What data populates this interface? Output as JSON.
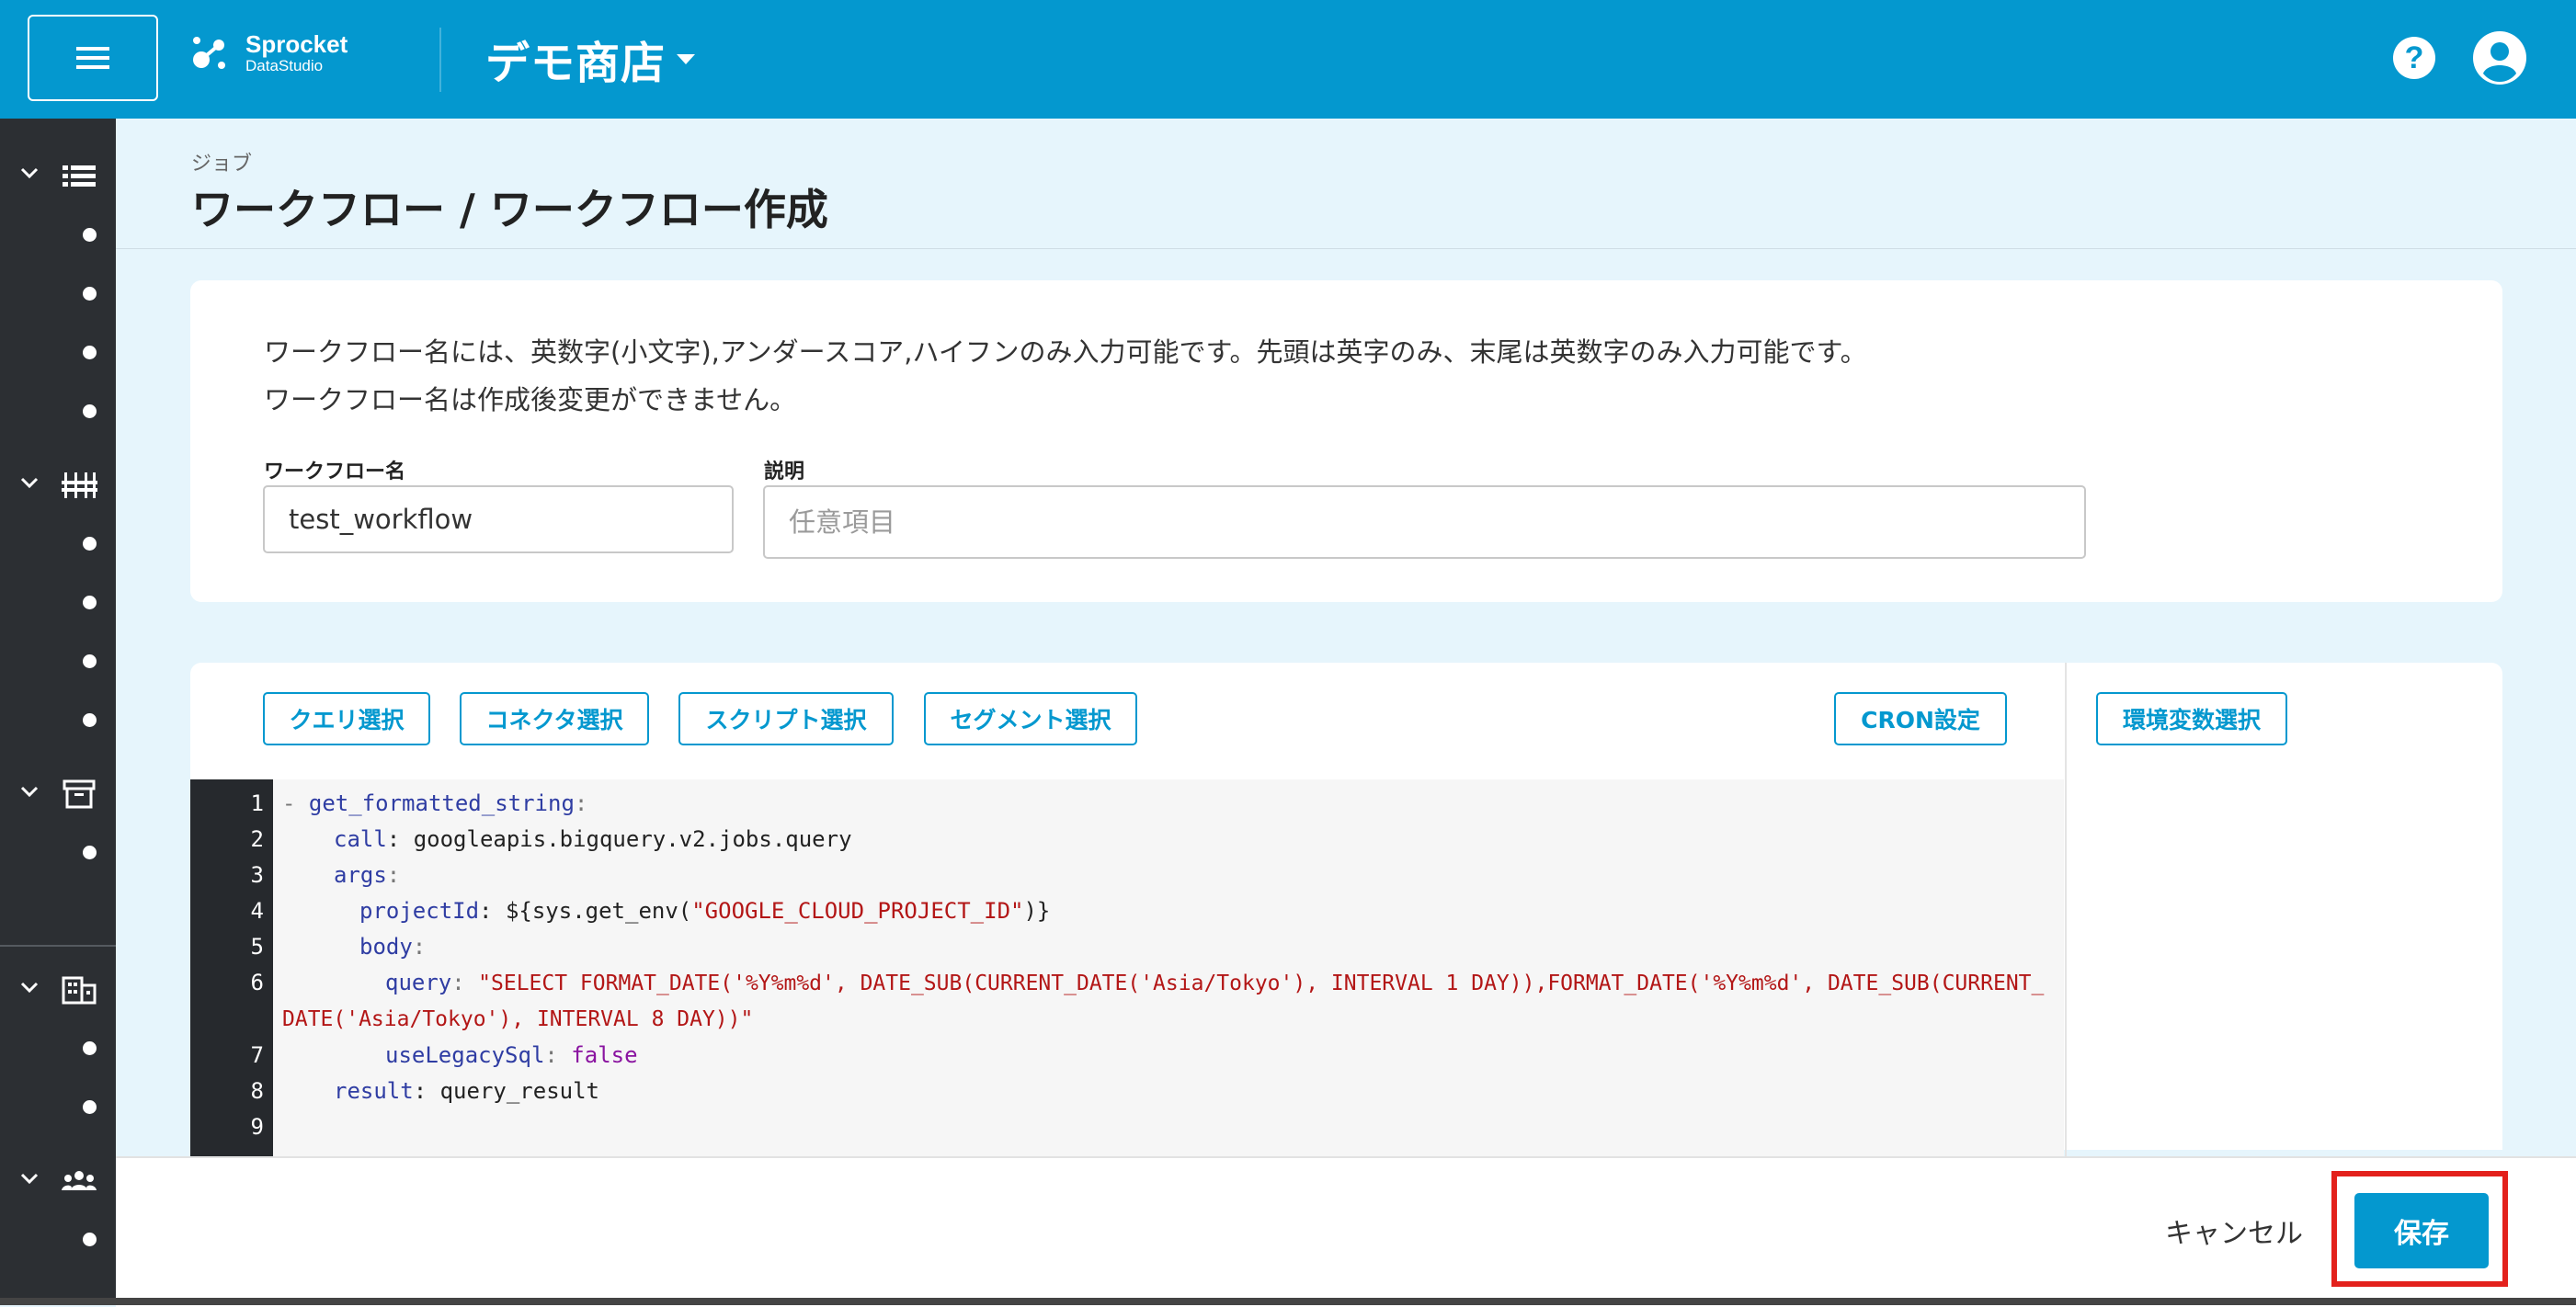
{
  "header": {
    "logo_name": "Sprocket",
    "logo_sub": "DataStudio",
    "store_name": "デモ商店",
    "help_glyph": "?"
  },
  "sidebar": {
    "groups": [
      {
        "icon": "list-icon",
        "dots": 4
      },
      {
        "icon": "pipeline-icon",
        "dots": 4
      },
      {
        "icon": "archive-icon",
        "dots": 1
      },
      {
        "icon": "building-icon",
        "dots": 2
      },
      {
        "icon": "people-icon",
        "dots": 1
      }
    ]
  },
  "page": {
    "breadcrumb": "ジョブ",
    "title": "ワークフロー / ワークフロー作成"
  },
  "form": {
    "note_line1": "ワークフロー名には、英数字(小文字),アンダースコア,ハイフンのみ入力可能です。先頭は英字のみ、末尾は英数字のみ入力可能です。",
    "note_line2": "ワークフロー名は作成後変更ができません。",
    "name_label": "ワークフロー名",
    "name_value": "test_workflow",
    "description_label": "説明",
    "description_placeholder": "任意項目"
  },
  "toolbar": {
    "query_select": "クエリ選択",
    "connector_select": "コネクタ選択",
    "script_select": "スクリプト選択",
    "segment_select": "セグメント選択",
    "cron_settings": "CRON設定",
    "env_var_select": "環境変数選択"
  },
  "editor": {
    "line_numbers": [
      "1",
      "2",
      "3",
      "4",
      "5",
      "6",
      "7",
      "8",
      "9"
    ],
    "lines": {
      "l1_dash": "- ",
      "l1_key": "get_formatted_string",
      "l1_colon": ":",
      "l2_key": "call",
      "l2_val": ": googleapis.bigquery.v2.jobs.query",
      "l3_key": "args",
      "l3_colon": ":",
      "l4_key": "projectId",
      "l4_mid": ": ${sys.get_env(",
      "l4_str": "\"GOOGLE_CLOUD_PROJECT_ID\"",
      "l4_end": ")}",
      "l5_key": "body",
      "l5_colon": ":",
      "l6_key": "query",
      "l6_colon": ": ",
      "l6_str_a": "\"SELECT FORMAT_DATE('%Y%m%d', DATE_SUB(CURRENT_DATE('Asia/Tokyo'), INTERVAL 1 DAY)),FORMAT_DATE('%Y%m%d', DATE_SUB(CURRENT_",
      "l6_str_b": "DATE('Asia/Tokyo'), INTERVAL 8 DAY))\"",
      "l7_key": "useLegacySql",
      "l7_colon": ": ",
      "l7_val": "false",
      "l8_key": "result",
      "l8_val": ": query_result"
    }
  },
  "footer": {
    "cancel_label": "キャンセル",
    "save_label": "保存"
  },
  "colors": {
    "brand": "#0498cf",
    "sidebar": "#2c2f33",
    "highlight": "#e3211c"
  }
}
